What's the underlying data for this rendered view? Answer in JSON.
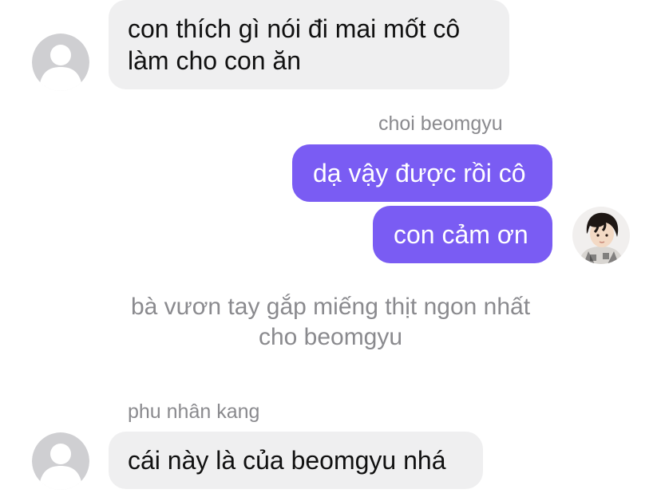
{
  "colors": {
    "incoming_bubble": "#efeff0",
    "outgoing_bubble": "#7a5cf3",
    "meta_text": "#8a8a8e",
    "default_avatar": "#cfcfd2"
  },
  "messages": [
    {
      "direction": "incoming",
      "lines": [
        "con thích gì nói đi mai mốt cô",
        "làm cho con ăn"
      ]
    },
    {
      "direction": "outgoing",
      "sender": "choi beomgyu",
      "lines": [
        "dạ vậy được rồi cô",
        "con cảm ơn"
      ]
    },
    {
      "direction": "narration",
      "lines": [
        "bà vươn tay gắp miếng thịt ngon nhất",
        "cho beomgyu"
      ]
    },
    {
      "direction": "incoming",
      "sender": "phu nhân kang",
      "lines": [
        "cái này là của beomgyu nhá"
      ]
    }
  ],
  "icons": {
    "default_avatar": "person-silhouette-icon",
    "photo_avatar": "profile-photo"
  }
}
